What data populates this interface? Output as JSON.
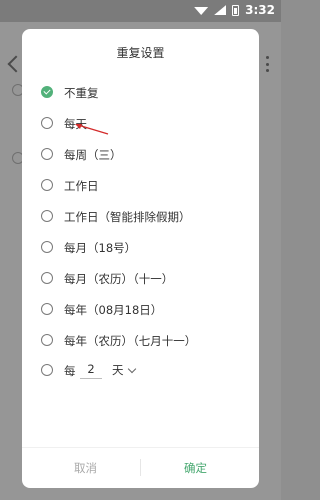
{
  "status_bar": {
    "time": "3:32"
  },
  "dialog": {
    "title": "重复设置",
    "options": [
      {
        "label": "不重复",
        "selected": true
      },
      {
        "label": "每天",
        "selected": false
      },
      {
        "label": "每周（三）",
        "selected": false
      },
      {
        "label": "工作日",
        "selected": false
      },
      {
        "label": "工作日（智能排除假期）",
        "selected": false
      },
      {
        "label": "每月（18号）",
        "selected": false
      },
      {
        "label": "每月（农历）（十一）",
        "selected": false
      },
      {
        "label": "每年（08月18日）",
        "selected": false
      },
      {
        "label": "每年（农历）（七月十一）",
        "selected": false
      }
    ],
    "custom": {
      "prefix": "每",
      "value": "2",
      "unit": "天"
    },
    "buttons": {
      "cancel": "取消",
      "ok": "确定"
    }
  },
  "colors": {
    "accent": "#52b17a",
    "confirm": "#47a870",
    "annotation": "#d32b2b"
  }
}
